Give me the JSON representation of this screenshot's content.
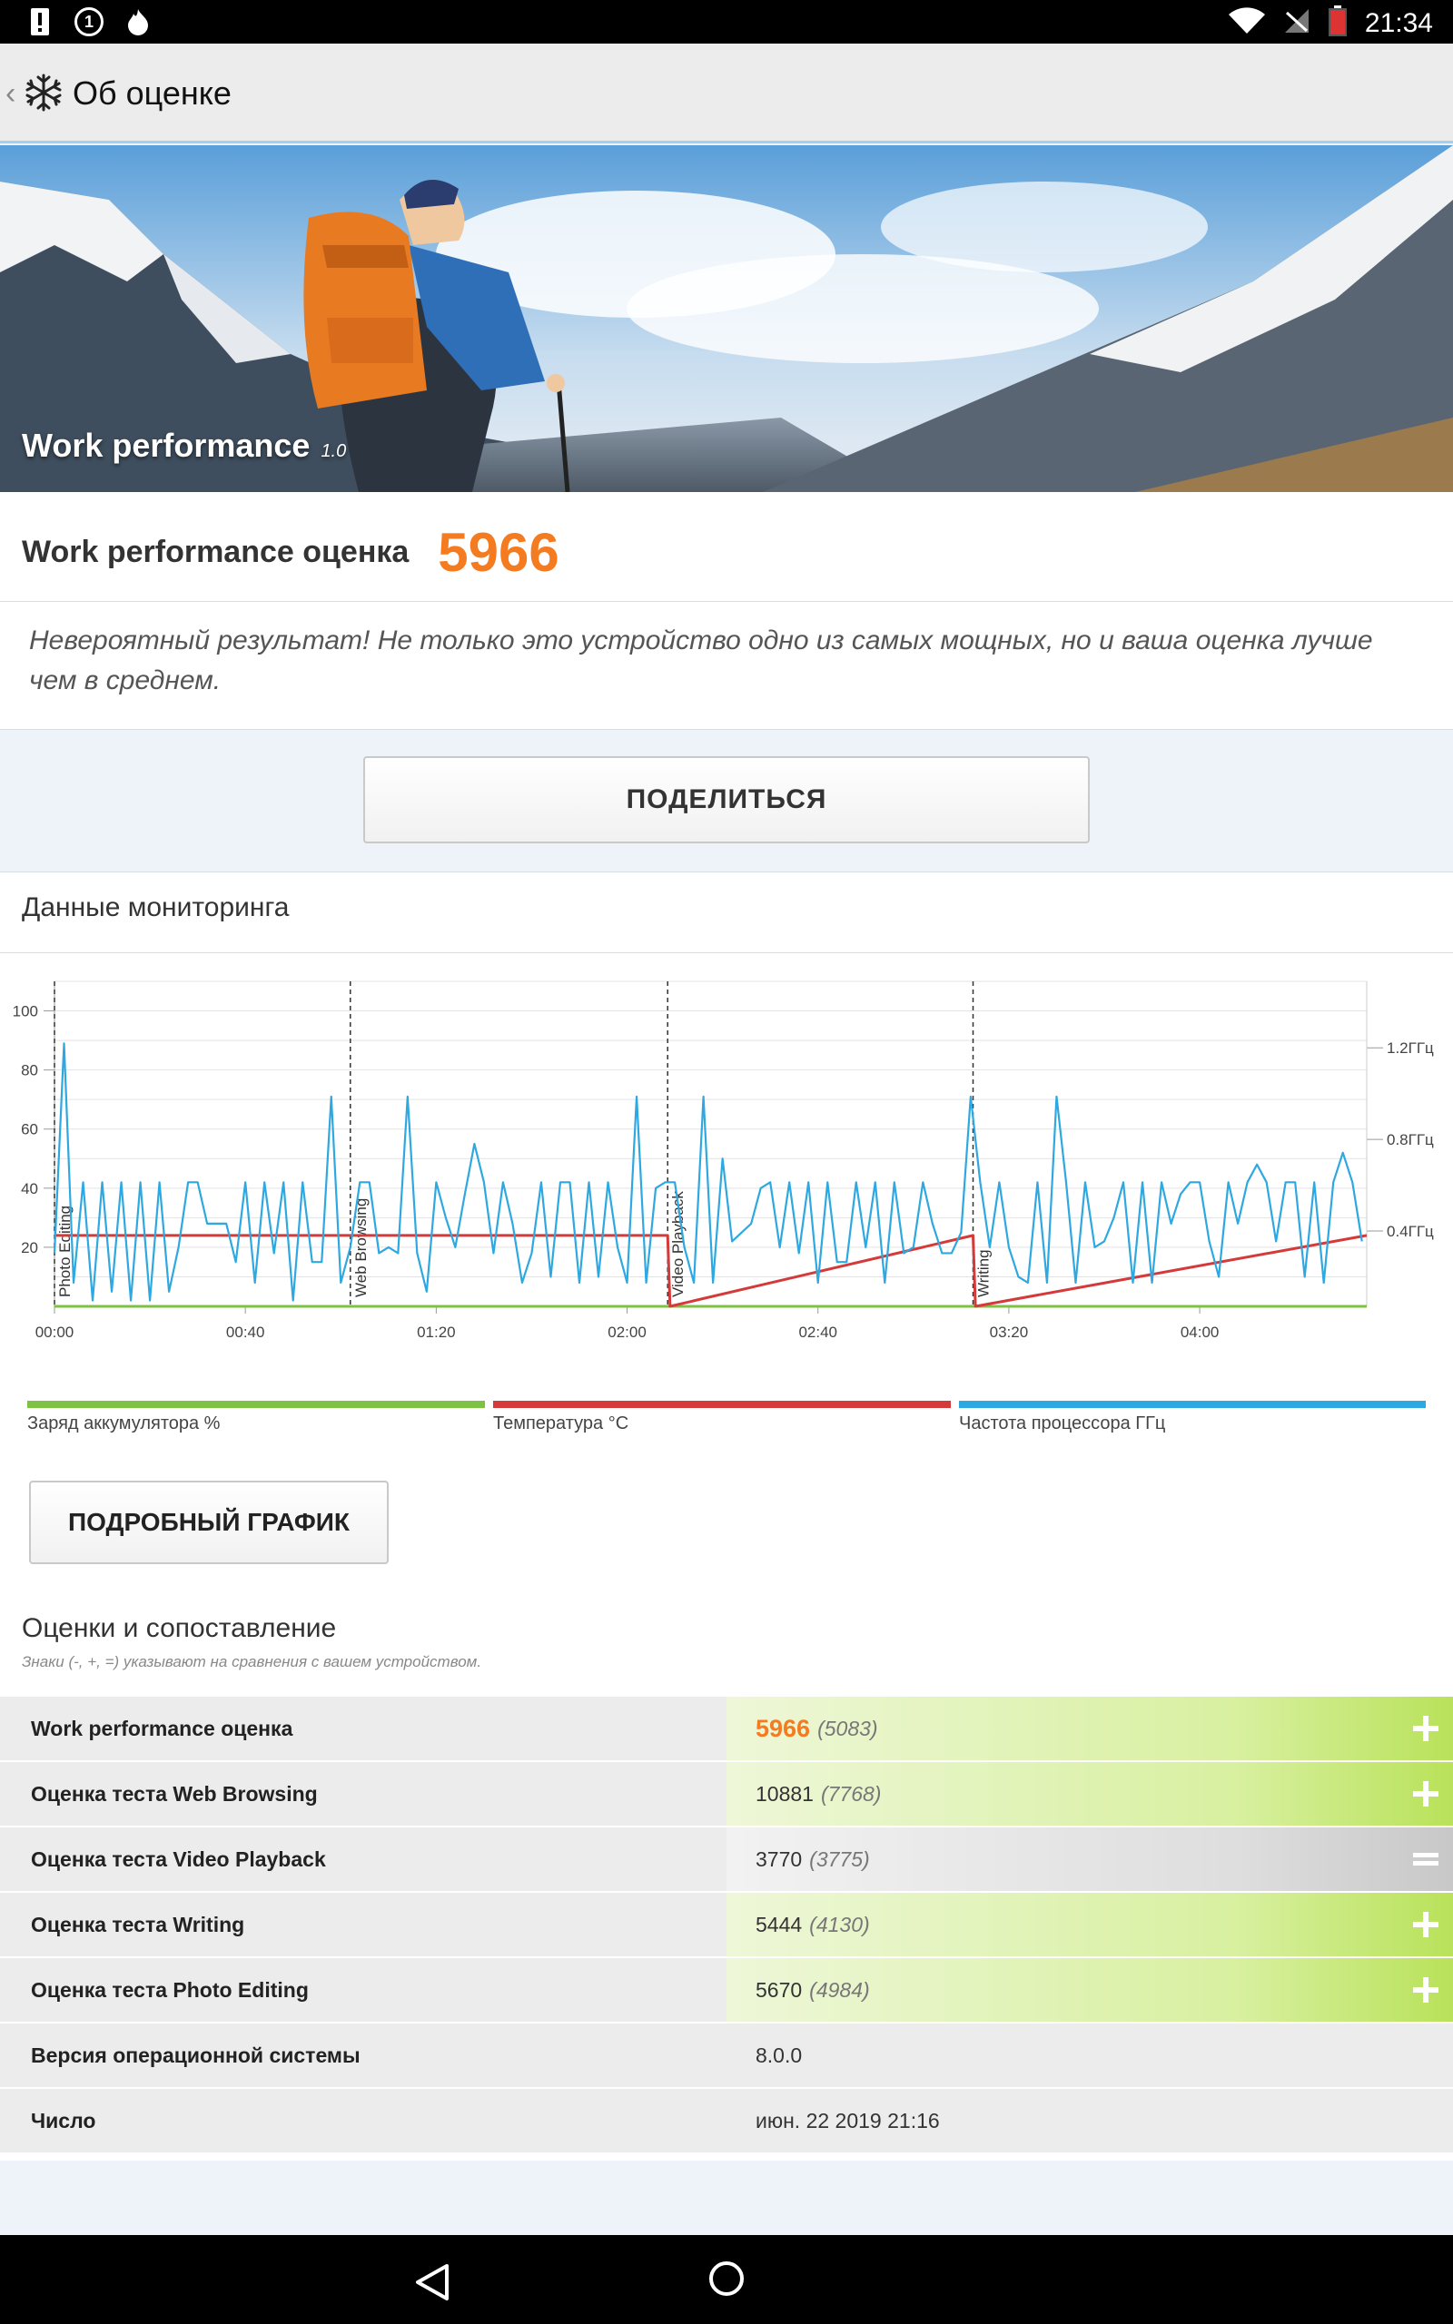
{
  "status_bar": {
    "time": "21:34",
    "notification_count": "1"
  },
  "app_bar": {
    "title": "Об оценке"
  },
  "banner": {
    "title": "Work performance",
    "version": "1.0"
  },
  "score": {
    "label": "Work performance оценка",
    "value": "5966",
    "description": "Невероятный результат! Не только это устройство одно из самых мощных, но и ваша оценка лучше чем в среднем."
  },
  "share_button": {
    "label": "ПОДЕЛИТЬСЯ"
  },
  "monitoring": {
    "title": "Данные мониторинга",
    "legend": [
      {
        "label": "Заряд аккумулятора %",
        "color": "#7dc242"
      },
      {
        "label": "Температура °C",
        "color": "#d43a3a"
      },
      {
        "label": "Частота процессора ГГц",
        "color": "#2ea8e0"
      }
    ],
    "detail_button": {
      "label": "ПОДРОБНЫЙ ГРАФИК"
    }
  },
  "chart_data": {
    "type": "line",
    "x_ticks": [
      "00:00",
      "00:40",
      "01:20",
      "02:00",
      "02:40",
      "03:20",
      "04:00"
    ],
    "y_left_ticks": [
      "20",
      "40",
      "60",
      "80",
      "100"
    ],
    "y_right_ticks": [
      "0.4ГГц",
      "0.8ГГц",
      "1.2ГГц"
    ],
    "y_left_range": [
      0,
      100
    ],
    "x_range_minutes": [
      0,
      275
    ],
    "sections": [
      {
        "label": "Photo Editing",
        "start_min": 0
      },
      {
        "label": "Web Browsing",
        "start_min": 62
      },
      {
        "label": "Video Playback",
        "start_min": 128.5
      },
      {
        "label": "Writing",
        "start_min": 192.5
      }
    ],
    "series": [
      {
        "name": "Заряд аккумулятора %",
        "color": "#7dc242",
        "x": [
          0,
          275
        ],
        "values": [
          0,
          0
        ]
      },
      {
        "name": "Температура °C",
        "color": "#d43a3a",
        "x": [
          0,
          62,
          128.5,
          129,
          192.5,
          193,
          275
        ],
        "values": [
          24,
          24,
          24,
          0,
          24,
          0,
          24
        ]
      },
      {
        "name": "Частота процессора ГГц",
        "color": "#2ea8e0",
        "x": [
          0,
          2,
          4,
          6,
          8,
          10,
          12,
          14,
          16,
          18,
          20,
          22,
          24,
          26,
          28,
          30,
          32,
          34,
          36,
          38,
          40,
          42,
          44,
          46,
          48,
          50,
          52,
          54,
          56,
          58,
          60,
          62,
          64,
          66,
          68,
          70,
          72,
          74,
          76,
          78,
          80,
          82,
          84,
          86,
          88,
          90,
          92,
          94,
          96,
          98,
          100,
          102,
          104,
          106,
          108,
          110,
          112,
          114,
          116,
          118,
          120,
          122,
          124,
          126,
          128,
          130,
          132,
          134,
          136,
          138,
          140,
          142,
          144,
          146,
          148,
          150,
          152,
          154,
          156,
          158,
          160,
          162,
          164,
          166,
          168,
          170,
          172,
          174,
          176,
          178,
          180,
          182,
          184,
          186,
          188,
          190,
          192,
          194,
          196,
          198,
          200,
          202,
          204,
          206,
          208,
          210,
          212,
          214,
          216,
          218,
          220,
          222,
          224,
          226,
          228,
          230,
          232,
          234,
          236,
          238,
          240,
          242,
          244,
          246,
          248,
          250,
          252,
          254,
          256,
          258,
          260,
          262,
          264,
          266,
          268,
          270,
          272,
          274
        ],
        "values": [
          18,
          89,
          8,
          42,
          2,
          42,
          5,
          42,
          2,
          42,
          2,
          42,
          5,
          20,
          42,
          42,
          28,
          28,
          28,
          15,
          42,
          8,
          42,
          18,
          42,
          2,
          42,
          15,
          15,
          71,
          8,
          20,
          42,
          42,
          18,
          20,
          18,
          71,
          18,
          5,
          42,
          30,
          20,
          38,
          55,
          42,
          18,
          42,
          28,
          8,
          18,
          42,
          10,
          42,
          42,
          8,
          42,
          10,
          42,
          20,
          8,
          71,
          8,
          40,
          42,
          42,
          20,
          8,
          71,
          8,
          50,
          22,
          25,
          28,
          40,
          42,
          20,
          42,
          18,
          42,
          8,
          42,
          15,
          15,
          42,
          20,
          42,
          8,
          42,
          18,
          20,
          42,
          28,
          18,
          18,
          25,
          71,
          42,
          20,
          42,
          20,
          10,
          8,
          42,
          8,
          71,
          42,
          8,
          42,
          20,
          22,
          30,
          42,
          8,
          42,
          8,
          42,
          28,
          38,
          42,
          42,
          22,
          10,
          42,
          28,
          42,
          48,
          42,
          22,
          42,
          42,
          10,
          42,
          8,
          42,
          52,
          42,
          22
        ]
      }
    ]
  },
  "comparison": {
    "title": "Оценки и сопоставление",
    "subtitle": "Знаки (-, +, =) указывают на сравнения с вашем устройством.",
    "rows": [
      {
        "label": "Work performance оценка",
        "value": "5966",
        "compare": "(5083)",
        "sign": "+"
      },
      {
        "label": "Оценка теста Web Browsing",
        "value": "10881",
        "compare": "(7768)",
        "sign": "+"
      },
      {
        "label": "Оценка теста Video Playback",
        "value": "3770",
        "compare": "(3775)",
        "sign": "="
      },
      {
        "label": "Оценка теста Writing",
        "value": "5444",
        "compare": "(4130)",
        "sign": "+"
      },
      {
        "label": "Оценка теста Photo Editing",
        "value": "5670",
        "compare": "(4984)",
        "sign": "+"
      },
      {
        "label": "Версия операционной системы",
        "value": "8.0.0"
      },
      {
        "label": "Число",
        "value": "июн. 22 2019 21:16"
      }
    ]
  },
  "colors": {
    "accent": "#f47b20",
    "link_blue": "#9fd2ec"
  }
}
